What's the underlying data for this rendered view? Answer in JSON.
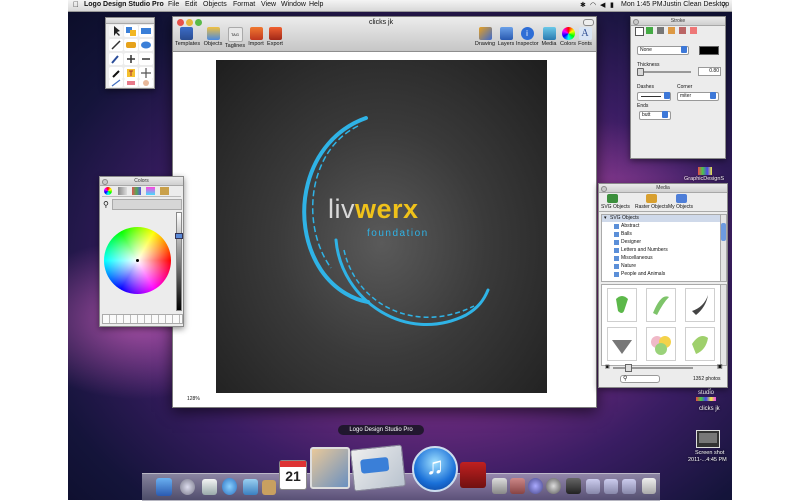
{
  "menubar": {
    "app_name": "Logo Design Studio Pro",
    "items": [
      "File",
      "Edit",
      "Objects",
      "Format",
      "View",
      "Window",
      "Help"
    ],
    "clock": "Mon 1:45 PM",
    "user": "Justin Clean Desktop"
  },
  "document": {
    "title": "clicks jk",
    "zoom": "128%"
  },
  "toolbar_left": [
    "Templates",
    "Objects",
    "Taglines",
    "Import",
    "Export"
  ],
  "toolbar_right": [
    "Drawing",
    "Layers",
    "Inspector",
    "Media",
    "Colors",
    "Fonts"
  ],
  "logo": {
    "part1": "liv",
    "part2": "werx",
    "tagline": "foundation",
    "accent_color": "#2fb3e6",
    "highlight_color": "#f0c21a"
  },
  "colors_panel": {
    "title": "Colors"
  },
  "stroke_panel": {
    "title": "Stroke",
    "style_value": "None",
    "thickness_label": "Thickness",
    "thickness_value": "0.80",
    "dashes_label": "Dashes",
    "corner_label": "Corner",
    "corner_value": "miter",
    "ends_label": "Ends",
    "ends_value": "butt"
  },
  "media_panel": {
    "title": "Media",
    "tabs": [
      "SVG Objects",
      "Raster Objects",
      "My Objects"
    ],
    "tree_root": "SVG Objects",
    "tree_items": [
      "Abstract",
      "Balls",
      "Designer",
      "Letters and Numbers",
      "Miscellaneous",
      "Nature",
      "People and Animals"
    ],
    "photo_count": "1352 photos"
  },
  "desktop_icons": {
    "graphic_label": "GraphicDesignS",
    "design_studio_line1": "design",
    "design_studio_line2": "studio",
    "clicks_label": "clicks jk",
    "screenshot_label1": "Screen shot",
    "screenshot_label2": "2011-...4:45 PM"
  },
  "dock": {
    "tooltip": "Logo Design Studio Pro",
    "calendar_day": "21"
  }
}
